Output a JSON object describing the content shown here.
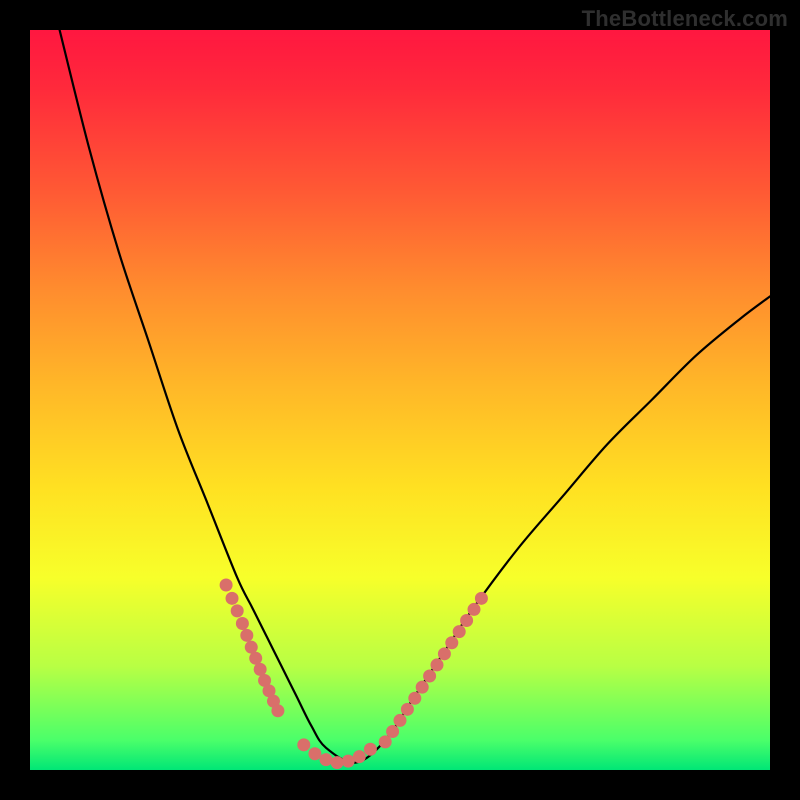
{
  "watermark": {
    "text": "TheBottleneck.com"
  },
  "chart_data": {
    "type": "line",
    "title": "",
    "xlabel": "",
    "ylabel": "",
    "xlim": [
      0,
      100
    ],
    "ylim": [
      0,
      100
    ],
    "grid": false,
    "series": [
      {
        "name": "bottleneck-curve",
        "color": "#000000",
        "x": [
          4,
          8,
          12,
          16,
          20,
          24,
          28,
          30,
          32,
          34,
          36,
          38,
          40,
          44,
          48,
          52,
          56,
          60,
          66,
          72,
          78,
          84,
          90,
          96,
          100
        ],
        "values": [
          100,
          84,
          70,
          58,
          46,
          36,
          26,
          22,
          18,
          14,
          10,
          6,
          3,
          1,
          4,
          10,
          16,
          22,
          30,
          37,
          44,
          50,
          56,
          61,
          64
        ]
      }
    ],
    "highlight_segments": [
      {
        "name": "left-dots",
        "color": "#d96f6a",
        "x": [
          26.5,
          27.3,
          28.0,
          28.7,
          29.3,
          29.9,
          30.5,
          31.1,
          31.7,
          32.3,
          32.9,
          33.5
        ],
        "values": [
          25.0,
          23.2,
          21.5,
          19.8,
          18.2,
          16.6,
          15.1,
          13.6,
          12.1,
          10.7,
          9.3,
          8.0
        ]
      },
      {
        "name": "right-dots",
        "color": "#d96f6a",
        "x": [
          48.0,
          49.0,
          50.0,
          51.0,
          52.0,
          53.0,
          54.0,
          55.0,
          56.0,
          57.0,
          58.0,
          59.0,
          60.0,
          61.0
        ],
        "values": [
          3.8,
          5.2,
          6.7,
          8.2,
          9.7,
          11.2,
          12.7,
          14.2,
          15.7,
          17.2,
          18.7,
          20.2,
          21.7,
          23.2
        ]
      },
      {
        "name": "bottom-dots",
        "color": "#d96f6a",
        "x": [
          37.0,
          38.5,
          40.0,
          41.5,
          43.0,
          44.5,
          46.0
        ],
        "values": [
          3.4,
          2.2,
          1.4,
          1.0,
          1.2,
          1.8,
          2.8
        ]
      }
    ]
  }
}
